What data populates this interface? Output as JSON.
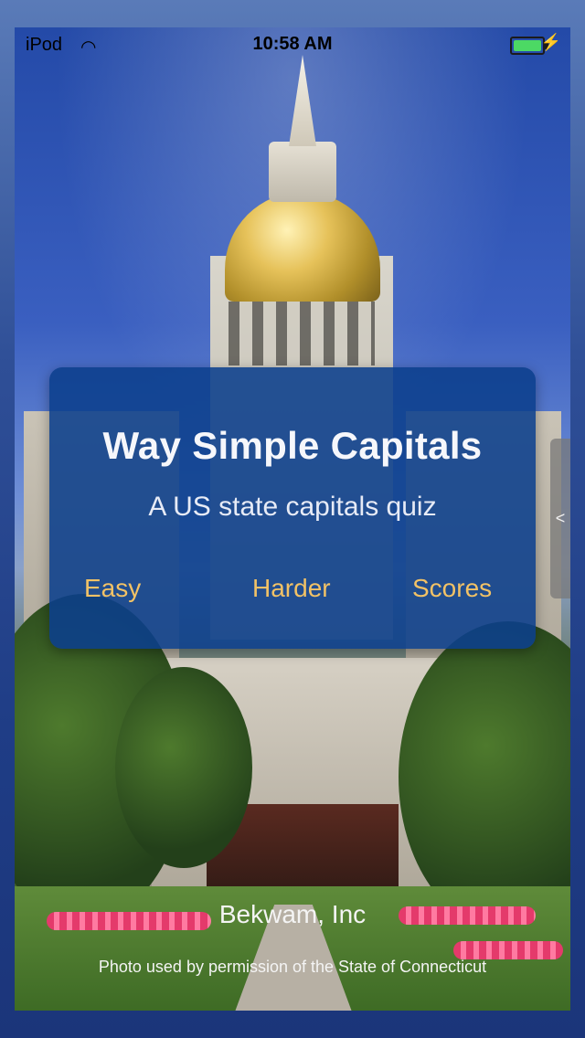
{
  "status_bar": {
    "carrier": "iPod",
    "time": "10:58 AM",
    "icons": [
      "wifi-icon",
      "battery-icon",
      "charging-bolt-icon"
    ]
  },
  "app": {
    "title": "Way Simple Capitals",
    "subtitle": "A US state capitals quiz",
    "buttons": {
      "easy": "Easy",
      "harder": "Harder",
      "scores": "Scores"
    },
    "side_tab": "<",
    "company": "Bekwam, Inc",
    "photo_credit": "Photo used by permission of the State of Connecticut"
  },
  "colors": {
    "panel": "#0b3f8c",
    "button_text": "#f2c266",
    "text": "#f6f7fb",
    "background_dark_blue": "#1f3d86"
  }
}
